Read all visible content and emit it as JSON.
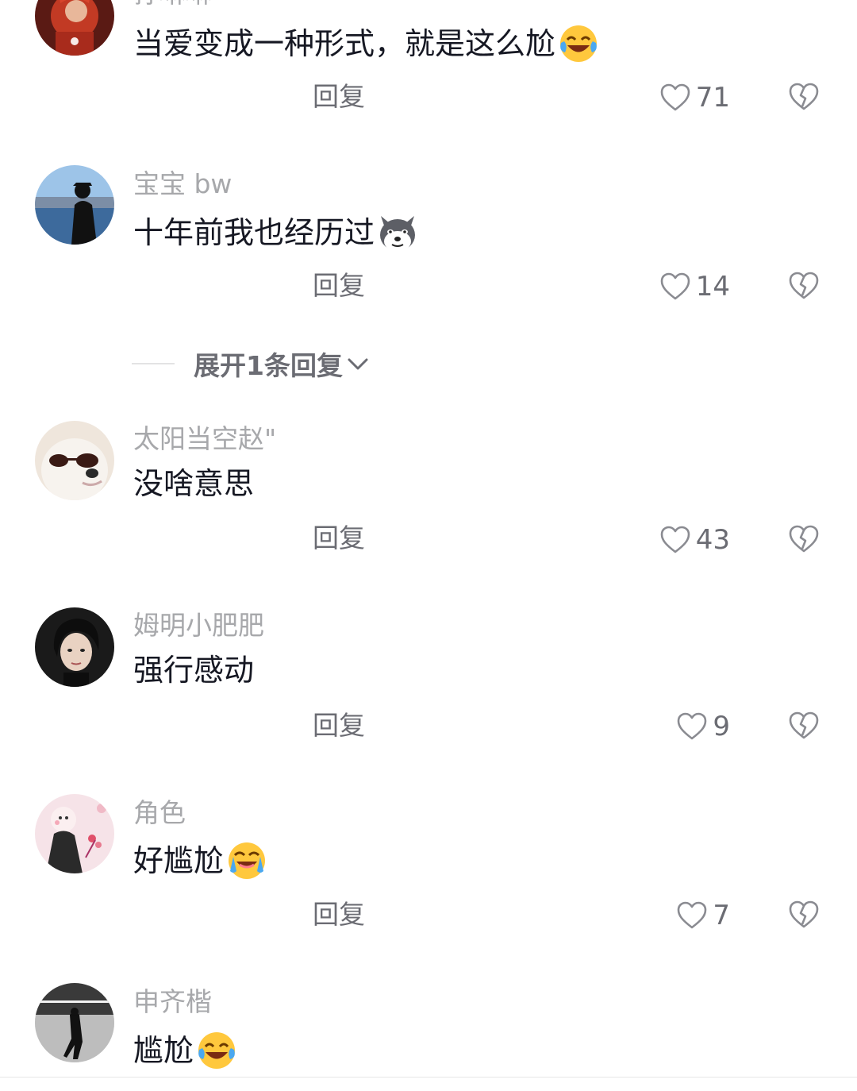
{
  "comments": [
    {
      "username": "孙琳琳",
      "text": "当爱变成一种形式，就是这么尬",
      "emoji": "laughing-tears-emoji",
      "reply_label": "回复",
      "likes": "71"
    },
    {
      "username": "宝宝 bw",
      "text": "十年前我也经历过",
      "emoji": "husky-dog-emoji",
      "reply_label": "回复",
      "likes": "14"
    },
    {
      "username": "太阳当空赵\"",
      "text": "没啥意思",
      "emoji": "",
      "reply_label": "回复",
      "likes": "43"
    },
    {
      "username": "姆明小肥肥",
      "text": "强行感动",
      "emoji": "",
      "reply_label": "回复",
      "likes": "9"
    },
    {
      "username": "角色",
      "text": "好尴尬",
      "emoji": "crying-laughing-emoji",
      "reply_label": "回复",
      "likes": "7"
    },
    {
      "username": "申齐楷",
      "text": "尴尬",
      "emoji": "laughing-tears-emoji"
    }
  ],
  "expand_replies": {
    "label": "展开1条回复"
  },
  "icons": {
    "like": "heart-outline-icon",
    "dislike": "broken-heart-icon",
    "expand": "chevron-down-icon"
  },
  "colors": {
    "text": "#161823",
    "username": "#a7a8ab",
    "secondary": "#6b6c73",
    "emoji_yellow": "#ffc83d"
  }
}
